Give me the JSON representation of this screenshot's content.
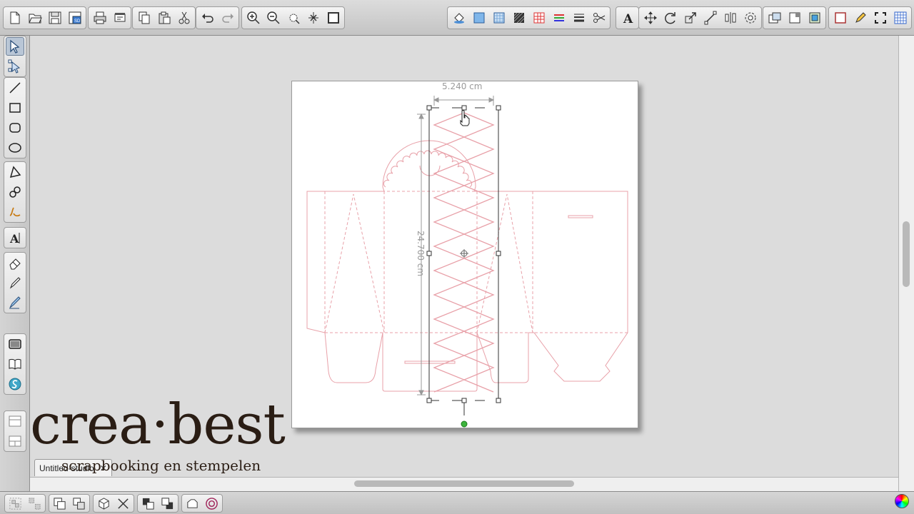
{
  "top_toolbar": {
    "groups": [
      {
        "name": "file",
        "tools": [
          "new-document-icon",
          "open-folder-icon",
          "save-icon",
          "save-as-icon"
        ]
      },
      {
        "name": "print",
        "tools": [
          "print-icon",
          "print-setup-icon"
        ]
      },
      {
        "name": "clipboard",
        "tools": [
          "copy-icon",
          "paste-icon",
          "cut-icon"
        ]
      },
      {
        "name": "history",
        "tools": [
          "undo-icon",
          "redo-icon"
        ]
      },
      {
        "name": "zoom",
        "tools": [
          "zoom-in-icon",
          "zoom-out-icon",
          "zoom-selection-icon",
          "fit-page-icon",
          "actual-size-icon"
        ]
      },
      {
        "name": "panels",
        "tools": [
          "fill-icon",
          "fill-color-icon",
          "pattern-icon",
          "texture-icon",
          "grid-fill-icon",
          "line-color-icon",
          "line-style-icon",
          "cut-line-icon"
        ]
      },
      {
        "name": "text",
        "tools": [
          "text-style-icon"
        ]
      },
      {
        "name": "arrange",
        "tools": [
          "move-icon",
          "rotate-icon",
          "scale-icon",
          "distort-icon",
          "align-icon",
          "replicate-icon"
        ]
      },
      {
        "name": "library",
        "tools": [
          "library-icon",
          "view-settings-icon",
          "page-settings-icon"
        ]
      },
      {
        "name": "view",
        "tools": [
          "page-icon",
          "pen-icon",
          "fullscreen-icon",
          "grid-icon"
        ]
      }
    ]
  },
  "left_toolbar": {
    "groups": [
      [
        "select-icon",
        "edit-points-icon"
      ],
      [
        "line-tool-icon",
        "rectangle-tool-icon",
        "rounded-rectangle-tool-icon",
        "ellipse-tool-icon"
      ],
      [
        "polygon-tool-icon",
        "curve-tool-icon",
        "freehand-tool-icon"
      ],
      [
        "text-tool-icon"
      ],
      [
        "eraser-tool-icon",
        "knife-tool-icon",
        "paint-tool-icon"
      ],
      [
        "screen-view-icon",
        "library-book-icon",
        "silhouette-store-icon"
      ],
      [
        "panel-top-icon",
        "panel-bottom-icon"
      ]
    ]
  },
  "canvas": {
    "width_dimension": "5.240 cm",
    "height_dimension": "24.700 cm"
  },
  "document_tab": {
    "title": "Untitled-studio",
    "close_glyph": "✕"
  },
  "watermark": {
    "brand": "crea·best",
    "tagline": "scrapbooking en stempelen"
  },
  "bottom_toolbar": {
    "groups": [
      [
        "group-icon",
        "ungroup-icon"
      ],
      [
        "compound-icon",
        "release-compound-icon"
      ],
      [
        "3d-icon",
        "delete-icon"
      ],
      [
        "bring-front-icon",
        "send-back-icon"
      ],
      [
        "weld-icon",
        "offset-icon"
      ]
    ]
  },
  "colors": {
    "cut_line": "#e8a0a8",
    "selection": "#333333",
    "dimension": "#999999",
    "rotate_handle": "#3cb43c"
  }
}
